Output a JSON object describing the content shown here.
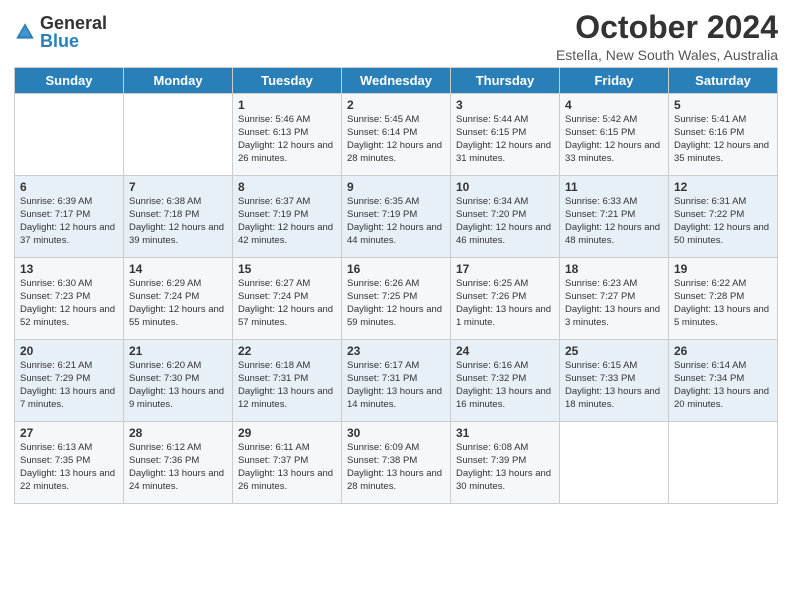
{
  "header": {
    "logo_general": "General",
    "logo_blue": "Blue",
    "title": "October 2024",
    "subtitle": "Estella, New South Wales, Australia"
  },
  "days_of_week": [
    "Sunday",
    "Monday",
    "Tuesday",
    "Wednesday",
    "Thursday",
    "Friday",
    "Saturday"
  ],
  "weeks": [
    [
      {
        "day": "",
        "info": ""
      },
      {
        "day": "",
        "info": ""
      },
      {
        "day": "1",
        "info": "Sunrise: 5:46 AM\nSunset: 6:13 PM\nDaylight: 12 hours\nand 26 minutes."
      },
      {
        "day": "2",
        "info": "Sunrise: 5:45 AM\nSunset: 6:14 PM\nDaylight: 12 hours\nand 28 minutes."
      },
      {
        "day": "3",
        "info": "Sunrise: 5:44 AM\nSunset: 6:15 PM\nDaylight: 12 hours\nand 31 minutes."
      },
      {
        "day": "4",
        "info": "Sunrise: 5:42 AM\nSunset: 6:15 PM\nDaylight: 12 hours\nand 33 minutes."
      },
      {
        "day": "5",
        "info": "Sunrise: 5:41 AM\nSunset: 6:16 PM\nDaylight: 12 hours\nand 35 minutes."
      }
    ],
    [
      {
        "day": "6",
        "info": "Sunrise: 6:39 AM\nSunset: 7:17 PM\nDaylight: 12 hours\nand 37 minutes."
      },
      {
        "day": "7",
        "info": "Sunrise: 6:38 AM\nSunset: 7:18 PM\nDaylight: 12 hours\nand 39 minutes."
      },
      {
        "day": "8",
        "info": "Sunrise: 6:37 AM\nSunset: 7:19 PM\nDaylight: 12 hours\nand 42 minutes."
      },
      {
        "day": "9",
        "info": "Sunrise: 6:35 AM\nSunset: 7:19 PM\nDaylight: 12 hours\nand 44 minutes."
      },
      {
        "day": "10",
        "info": "Sunrise: 6:34 AM\nSunset: 7:20 PM\nDaylight: 12 hours\nand 46 minutes."
      },
      {
        "day": "11",
        "info": "Sunrise: 6:33 AM\nSunset: 7:21 PM\nDaylight: 12 hours\nand 48 minutes."
      },
      {
        "day": "12",
        "info": "Sunrise: 6:31 AM\nSunset: 7:22 PM\nDaylight: 12 hours\nand 50 minutes."
      }
    ],
    [
      {
        "day": "13",
        "info": "Sunrise: 6:30 AM\nSunset: 7:23 PM\nDaylight: 12 hours\nand 52 minutes."
      },
      {
        "day": "14",
        "info": "Sunrise: 6:29 AM\nSunset: 7:24 PM\nDaylight: 12 hours\nand 55 minutes."
      },
      {
        "day": "15",
        "info": "Sunrise: 6:27 AM\nSunset: 7:24 PM\nDaylight: 12 hours\nand 57 minutes."
      },
      {
        "day": "16",
        "info": "Sunrise: 6:26 AM\nSunset: 7:25 PM\nDaylight: 12 hours\nand 59 minutes."
      },
      {
        "day": "17",
        "info": "Sunrise: 6:25 AM\nSunset: 7:26 PM\nDaylight: 13 hours\nand 1 minute."
      },
      {
        "day": "18",
        "info": "Sunrise: 6:23 AM\nSunset: 7:27 PM\nDaylight: 13 hours\nand 3 minutes."
      },
      {
        "day": "19",
        "info": "Sunrise: 6:22 AM\nSunset: 7:28 PM\nDaylight: 13 hours\nand 5 minutes."
      }
    ],
    [
      {
        "day": "20",
        "info": "Sunrise: 6:21 AM\nSunset: 7:29 PM\nDaylight: 13 hours\nand 7 minutes."
      },
      {
        "day": "21",
        "info": "Sunrise: 6:20 AM\nSunset: 7:30 PM\nDaylight: 13 hours\nand 9 minutes."
      },
      {
        "day": "22",
        "info": "Sunrise: 6:18 AM\nSunset: 7:31 PM\nDaylight: 13 hours\nand 12 minutes."
      },
      {
        "day": "23",
        "info": "Sunrise: 6:17 AM\nSunset: 7:31 PM\nDaylight: 13 hours\nand 14 minutes."
      },
      {
        "day": "24",
        "info": "Sunrise: 6:16 AM\nSunset: 7:32 PM\nDaylight: 13 hours\nand 16 minutes."
      },
      {
        "day": "25",
        "info": "Sunrise: 6:15 AM\nSunset: 7:33 PM\nDaylight: 13 hours\nand 18 minutes."
      },
      {
        "day": "26",
        "info": "Sunrise: 6:14 AM\nSunset: 7:34 PM\nDaylight: 13 hours\nand 20 minutes."
      }
    ],
    [
      {
        "day": "27",
        "info": "Sunrise: 6:13 AM\nSunset: 7:35 PM\nDaylight: 13 hours\nand 22 minutes."
      },
      {
        "day": "28",
        "info": "Sunrise: 6:12 AM\nSunset: 7:36 PM\nDaylight: 13 hours\nand 24 minutes."
      },
      {
        "day": "29",
        "info": "Sunrise: 6:11 AM\nSunset: 7:37 PM\nDaylight: 13 hours\nand 26 minutes."
      },
      {
        "day": "30",
        "info": "Sunrise: 6:09 AM\nSunset: 7:38 PM\nDaylight: 13 hours\nand 28 minutes."
      },
      {
        "day": "31",
        "info": "Sunrise: 6:08 AM\nSunset: 7:39 PM\nDaylight: 13 hours\nand 30 minutes."
      },
      {
        "day": "",
        "info": ""
      },
      {
        "day": "",
        "info": ""
      }
    ]
  ]
}
